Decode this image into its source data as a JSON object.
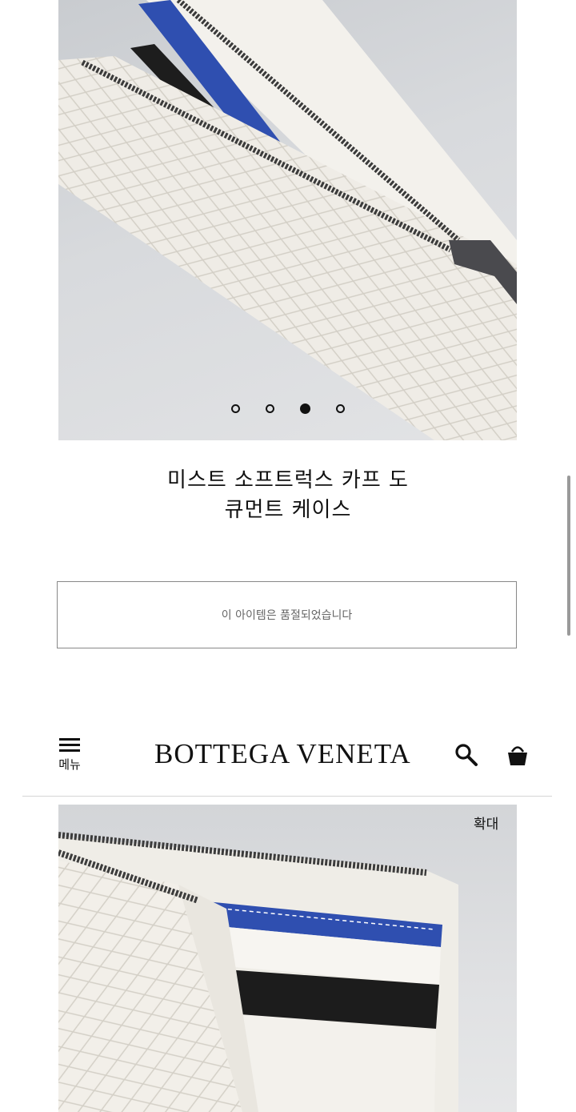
{
  "product": {
    "title_line1": "미스트 소프트럭스 카프 도",
    "title_line2": "큐먼트 케이스",
    "soldout_message": "이 아이템은 품절되었습니다",
    "carousel": {
      "total": 4,
      "active_index": 3
    }
  },
  "header": {
    "menu_label": "메뉴",
    "logo_text": "BOTTEGA VENETA",
    "icons": [
      "menu-icon",
      "search-icon",
      "shopping-bag-icon"
    ]
  },
  "gallery": {
    "zoom_label": "확대"
  },
  "colors": {
    "text": "#111111",
    "border": "#888888",
    "leather": "#eeebe4",
    "accent_blue": "#2f4fb0"
  }
}
